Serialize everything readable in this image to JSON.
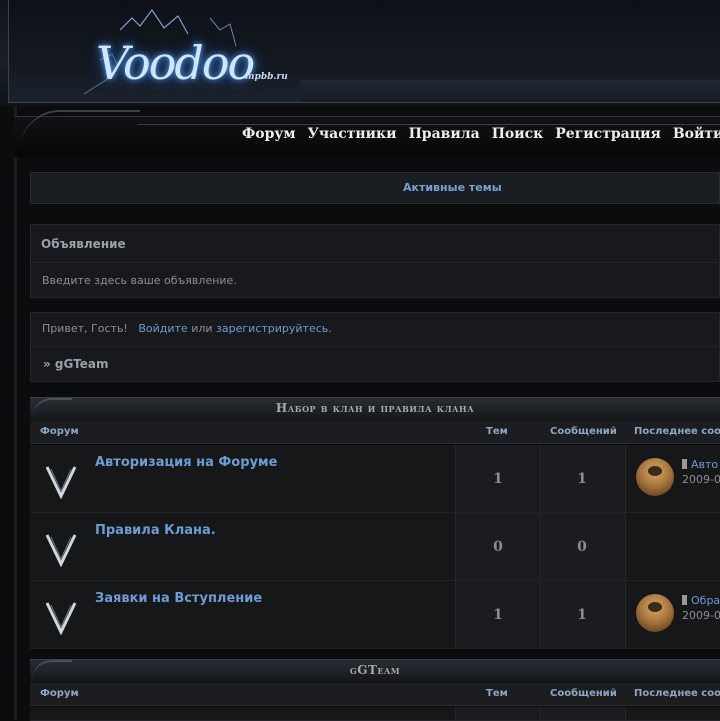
{
  "header": {
    "logo": "Voodoo",
    "logo_sub": "mpbb.ru"
  },
  "nav": {
    "items": [
      "Форум",
      "Участники",
      "Правила",
      "Поиск",
      "Регистрация",
      "Войти"
    ]
  },
  "active_topics": "Активные темы",
  "announcement": {
    "title": "Объявление",
    "text": "Введите здесь ваше объявление."
  },
  "welcome": {
    "greeting": "Привет, Гость!",
    "login": "Войдите",
    "or": "или",
    "register": "зарегистрируйтесь.",
    "breadcrumb": "» gGTeam"
  },
  "columns": {
    "forum": "Форум",
    "topics": "Тем",
    "posts": "Сообщений",
    "last": "Последнее соо"
  },
  "categories": [
    {
      "title": "Набор в клан и правила клана",
      "forums": [
        {
          "name": "Авторизация на Форуме",
          "topics": "1",
          "posts": "1",
          "last_title": "Авто",
          "last_date": "2009-0",
          "has_last": true
        },
        {
          "name": "Правила Клана.",
          "topics": "0",
          "posts": "0",
          "last_title": "",
          "last_date": "",
          "has_last": false
        },
        {
          "name": "Заявки на Вступление",
          "topics": "1",
          "posts": "1",
          "last_title": "Обра",
          "last_date": "2009-0",
          "has_last": true
        }
      ]
    },
    {
      "title": "gGTeam",
      "forums": []
    }
  ],
  "colors": {
    "link": "#6f9bd3",
    "background": "#0b0c0e"
  }
}
